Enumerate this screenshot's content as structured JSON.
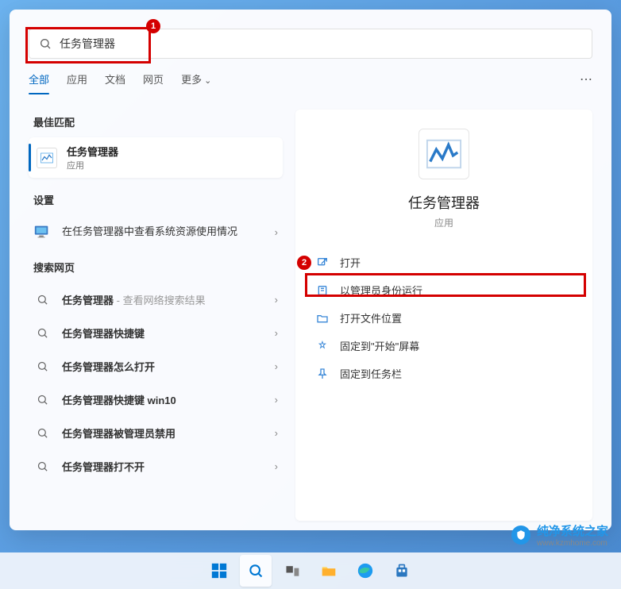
{
  "search": {
    "value": "任务管理器",
    "placeholder": ""
  },
  "tabs": [
    "全部",
    "应用",
    "文档",
    "网页",
    "更多"
  ],
  "sections": {
    "best": "最佳匹配",
    "settings": "设置",
    "web": "搜索网页"
  },
  "bestMatch": {
    "title": "任务管理器",
    "subtitle": "应用"
  },
  "settingsItem": "在任务管理器中查看系统资源使用情况",
  "webResults": [
    {
      "bold": "任务管理器",
      "rest": " - 查看网络搜索结果",
      "gray": true
    },
    {
      "bold": "任务管理器快捷键",
      "rest": ""
    },
    {
      "bold": "任务管理器怎么打开",
      "rest": ""
    },
    {
      "bold": "任务管理器快捷键 win10",
      "rest": ""
    },
    {
      "bold": "任务管理器被管理员禁用",
      "rest": ""
    },
    {
      "bold": "任务管理器打不开",
      "rest": ""
    }
  ],
  "detail": {
    "title": "任务管理器",
    "subtitle": "应用"
  },
  "actions": [
    "打开",
    "以管理员身份运行",
    "打开文件位置",
    "固定到\"开始\"屏幕",
    "固定到任务栏"
  ],
  "badges": {
    "one": "1",
    "two": "2"
  },
  "watermark": {
    "name": "纯净系统之家",
    "url": "www.kzmhome.com"
  }
}
